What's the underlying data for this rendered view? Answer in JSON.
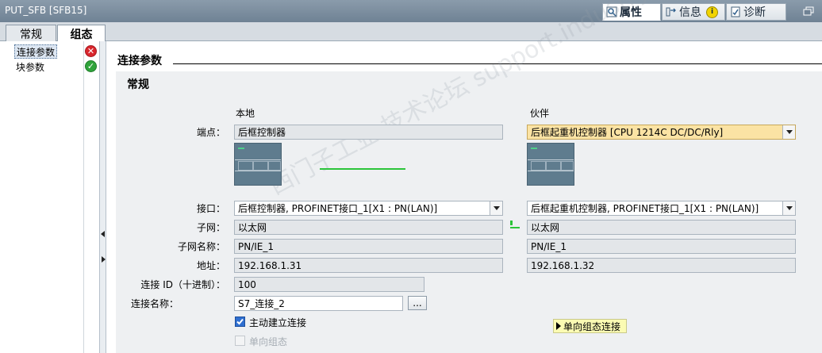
{
  "window": {
    "title": "PUT_SFB [SFB15]"
  },
  "inspector_tabs": [
    {
      "label": "属性",
      "icon": "properties-icon",
      "active": true
    },
    {
      "label": "信息",
      "icon": "info-icon",
      "active": false,
      "badge": "i"
    },
    {
      "label": "诊断",
      "icon": "diagnostics-icon",
      "active": false
    }
  ],
  "sub_tabs": [
    {
      "label": "常规",
      "active": false
    },
    {
      "label": "组态",
      "active": true
    }
  ],
  "nav": {
    "items": [
      {
        "label": "连接参数",
        "status": "error",
        "status_glyph": "✕"
      },
      {
        "label": "块参数",
        "status": "ok",
        "status_glyph": "✓"
      }
    ]
  },
  "section": {
    "heading": "连接参数",
    "panel_title": "常规"
  },
  "columns": {
    "local": "本地",
    "partner": "伙伴"
  },
  "labels": {
    "endpoint": "端点：",
    "interface": "接口：",
    "subnet": "子网：",
    "subnet_name": "子网名称：",
    "address": "地址：",
    "connection_id": "连接 ID（十进制）：",
    "connection_name": "连接名称："
  },
  "local": {
    "endpoint": "后框控制器",
    "interface": "后框控制器, PROFINET接口_1[X1 : PN(LAN)]",
    "subnet": "以太网",
    "subnet_name": "PN/IE_1",
    "address": "192.168.1.31"
  },
  "partner": {
    "endpoint": "后框起重机控制器 [CPU 1214C DC/DC/Rly]",
    "interface": "后框起重机控制器, PROFINET接口_1[X1 : PN(LAN)]",
    "subnet": "以太网",
    "subnet_name": "PN/IE_1",
    "address": "192.168.1.32"
  },
  "connection": {
    "id": "100",
    "name": "S7_连接_2",
    "browse_label": "...",
    "active_setup_label": "主动建立连接",
    "active_setup_checked": true,
    "one_way_label": "单向组态",
    "one_way_checked": false,
    "one_way_button": "单向组态连接"
  },
  "watermark": "西门子工业 技术论坛 support.industry.siemens.com",
  "colors": {
    "partner_highlight": "#fbe3a4",
    "link_green": "#2bc43a",
    "error": "#d9262d",
    "ok": "#2fa33b"
  }
}
